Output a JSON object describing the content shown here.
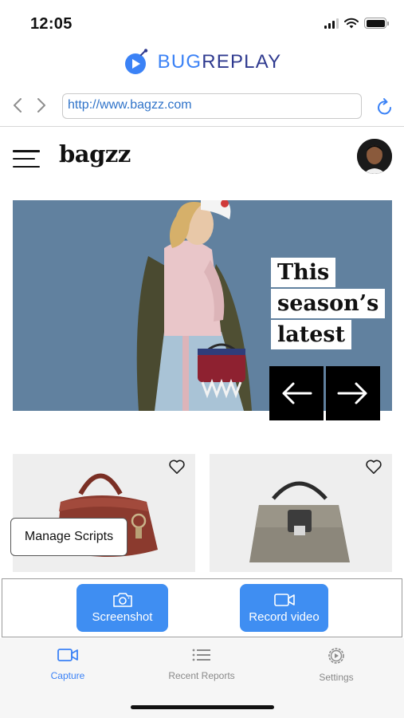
{
  "status_bar": {
    "time": "12:05"
  },
  "app": {
    "logo_bug": "BUG",
    "logo_replay": "REPLAY",
    "brand_color": "#3b82f6"
  },
  "browser": {
    "url": "http://www.bagzz.com"
  },
  "site": {
    "name": "bagzz",
    "hero": {
      "line1": "This",
      "line2": "season’s",
      "line3": "latest"
    },
    "products": [
      {
        "name": "maroon handbag",
        "color": "#8b3a2e"
      },
      {
        "name": "grey handbag",
        "color": "#8c877b"
      }
    ]
  },
  "tooltip": {
    "label": "Manage Scripts"
  },
  "actions": {
    "screenshot_label": "Screenshot",
    "record_label": "Record video"
  },
  "tabs": [
    {
      "label": "Capture",
      "icon": "video-camera-icon",
      "active": true
    },
    {
      "label": "Recent Reports",
      "icon": "list-icon",
      "active": false
    },
    {
      "label": "Settings",
      "icon": "gear-icon",
      "active": false
    }
  ],
  "colors": {
    "accent": "#3f8ef2",
    "hero_bg": "#5f7e9c"
  }
}
